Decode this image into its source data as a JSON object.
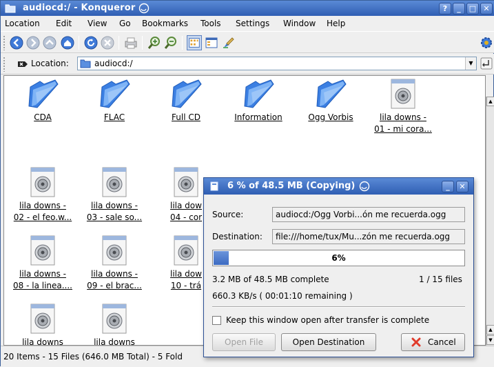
{
  "window": {
    "title": "audiocd:/ - Konqueror",
    "buttons": {
      "help": "?",
      "minimize": "_",
      "maximize": "□",
      "close": "✕"
    }
  },
  "menu": [
    {
      "label": "Location"
    },
    {
      "label": "Edit"
    },
    {
      "label": "View"
    },
    {
      "label": "Go"
    },
    {
      "label": "Bookmarks"
    },
    {
      "label": "Tools"
    },
    {
      "label": "Settings"
    },
    {
      "label": "Window"
    },
    {
      "label": "Help"
    }
  ],
  "location": {
    "label": "Location:",
    "value": "audiocd:/"
  },
  "files": [
    {
      "name": "CDA",
      "name2": "",
      "kind": "folder"
    },
    {
      "name": "FLAC",
      "name2": "",
      "kind": "folder"
    },
    {
      "name": "Full CD",
      "name2": "",
      "kind": "folder"
    },
    {
      "name": "Information",
      "name2": "",
      "kind": "folder"
    },
    {
      "name": "Ogg Vorbis",
      "name2": "",
      "kind": "folder"
    },
    {
      "name": "lila downs -",
      "name2": "01 - mi cora...",
      "kind": "audio"
    },
    {
      "name": "lila downs -",
      "name2": "02 - el feo.w...",
      "kind": "audio"
    },
    {
      "name": "lila downs -",
      "name2": "03 - sale so...",
      "kind": "audio"
    },
    {
      "name": "lila dow",
      "name2": "04 - cor",
      "kind": "audio"
    },
    {
      "name": "lila downs -",
      "name2": "08 - la linea....",
      "kind": "audio"
    },
    {
      "name": "lila downs -",
      "name2": "09 - el brac...",
      "kind": "audio"
    },
    {
      "name": "lila dow",
      "name2": "10 - trá",
      "kind": "audio"
    },
    {
      "name": "lila downs",
      "name2": "",
      "kind": "audio"
    },
    {
      "name": "lila downs",
      "name2": "",
      "kind": "audio"
    }
  ],
  "status": "20 Items - 15 Files (646.0 MB Total) - 5 Fold",
  "dialog": {
    "title": "6 % of 48.5 MB  (Copying)",
    "source_label": "Source:",
    "source_value": "audiocd:/Ogg Vorbi...ón me recuerda.ogg",
    "dest_label": "Destination:",
    "dest_value": "file:///home/tux/Mu...zón me recuerda.ogg",
    "progress": 0.06,
    "progress_label": "6%",
    "complete_text": "3.2 MB of 48.5 MB complete",
    "files_text": "1 / 15 files",
    "speed_text": "660.3 KB/s ( 00:01:10 remaining )",
    "keep_open_label": "Keep this window open after transfer is complete",
    "open_file": "Open File",
    "open_destination": "Open Destination",
    "cancel": "Cancel"
  }
}
